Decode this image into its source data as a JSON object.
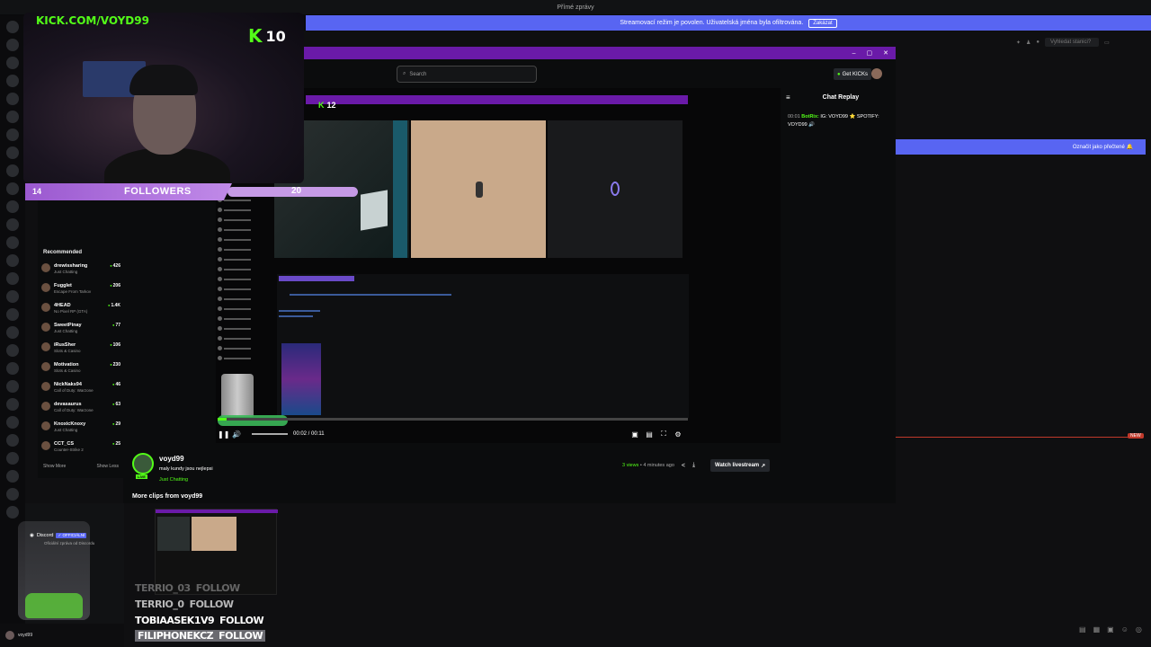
{
  "titlebar": {
    "title": "Přímé zprávy"
  },
  "notice": {
    "text": "Streamovací režim je povolen. Uživatelská jména byla ofiltrována.",
    "button": "Zakázat"
  },
  "outer": {
    "search_placeholder": "Vyhledat stanici?",
    "mark_read": "Označit jako přečtené",
    "new_badge": "NEW"
  },
  "overlay": {
    "kick_url": "KICK.COM/VOYD99",
    "kick_letter": "K",
    "kick_count": "10",
    "followers": {
      "current": "14",
      "label": "FOLLOWERS",
      "goal": "20"
    }
  },
  "kick": {
    "search_placeholder": "Search",
    "get_kicks": "Get KICKs",
    "sidebar": {
      "recommended_label": "Recommended",
      "streamers": [
        {
          "name": "drewissharing",
          "category": "Just Chatting",
          "viewers": "426"
        },
        {
          "name": "Fugglet",
          "category": "Escape From Tarkov",
          "viewers": "206"
        },
        {
          "name": "4HEAD",
          "category": "No Pixel RP (GTA)",
          "viewers": "1.4K"
        },
        {
          "name": "SweetPinay",
          "category": "Just Chatting",
          "viewers": "77"
        },
        {
          "name": "iRusSher",
          "category": "Slots & Casino",
          "viewers": "106"
        },
        {
          "name": "Motivation",
          "category": "Slots & Casino",
          "viewers": "230"
        },
        {
          "name": "NickNaks94",
          "category": "Call of Duty: Warzone",
          "viewers": "46"
        },
        {
          "name": "devasaurus",
          "category": "Call of Duty: Warzone",
          "viewers": "63"
        },
        {
          "name": "KnoxicKnoxy",
          "category": "Just Chatting",
          "viewers": "29"
        },
        {
          "name": "CCT_CS",
          "category": "Counter-Strike 2",
          "viewers": "25"
        }
      ],
      "show_more": "Show More",
      "show_less": "Show Less"
    },
    "inner": {
      "k_count": "12"
    },
    "player": {
      "time": "00:02 / 00:11",
      "progress": 0.02
    },
    "chat": {
      "header": "Chat Replay",
      "message": {
        "time": "00:01",
        "user": "BotRix:",
        "text": "IG: VOYD99 ⭐ SPOTIFY: VOYD99 🔊"
      }
    },
    "clip": {
      "channel": "voyd99",
      "title": "maly kundy jsou nejlepsi",
      "category": "Just Chatting",
      "live_badge": "LIVE",
      "views": "3 views",
      "ago": "• 4 minutes ago",
      "watch_button": "Watch livestream",
      "more_clips": "More clips from voyd99"
    }
  },
  "follow_alerts": [
    {
      "name": "TERRIO_03",
      "action": "FOLLOW"
    },
    {
      "name": "TERRIO_0",
      "action": "FOLLOW"
    },
    {
      "name": "TOBIAASEK1V9",
      "action": "FOLLOW"
    },
    {
      "name": "FILIPHONEKCZ",
      "action": "FOLLOW"
    }
  ],
  "discord": {
    "entry_name": "Discord",
    "entry_tag": "✓ OFFICIÁLNÍ",
    "entry_sub": "Oficiální zpráva od Discordu",
    "user_name": "voyd99"
  }
}
